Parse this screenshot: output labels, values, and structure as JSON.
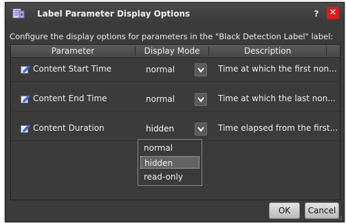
{
  "dialog": {
    "title": "Label Parameter Display Options",
    "help_label": "?",
    "close_label": "✕",
    "intro": "Configure the display options for parameters in the \"Black Detection Label\" label:"
  },
  "table": {
    "headers": [
      "Parameter",
      "Display Mode",
      "Description"
    ],
    "rows": [
      {
        "name": "Content Start Time",
        "mode": "normal",
        "description": "Time at which the first non..."
      },
      {
        "name": "Content End Time",
        "mode": "normal",
        "description": "Time at which the last non..."
      },
      {
        "name": "Content Duration",
        "mode": "hidden",
        "description": "Time elapsed from the first..."
      }
    ]
  },
  "dropdown": {
    "options": [
      "normal",
      "hidden",
      "read-only"
    ],
    "selected": "hidden"
  },
  "buttons": {
    "ok": "OK",
    "cancel": "Cancel"
  },
  "colors": {
    "dialog_bg": "#3b3b3b",
    "close_button": "#d61d1d",
    "header_bg": "#4f4f4f"
  },
  "icons": {
    "title": "parameters-icon",
    "row": "edit-pencil-icon",
    "arrow": "chevron-down-icon"
  }
}
